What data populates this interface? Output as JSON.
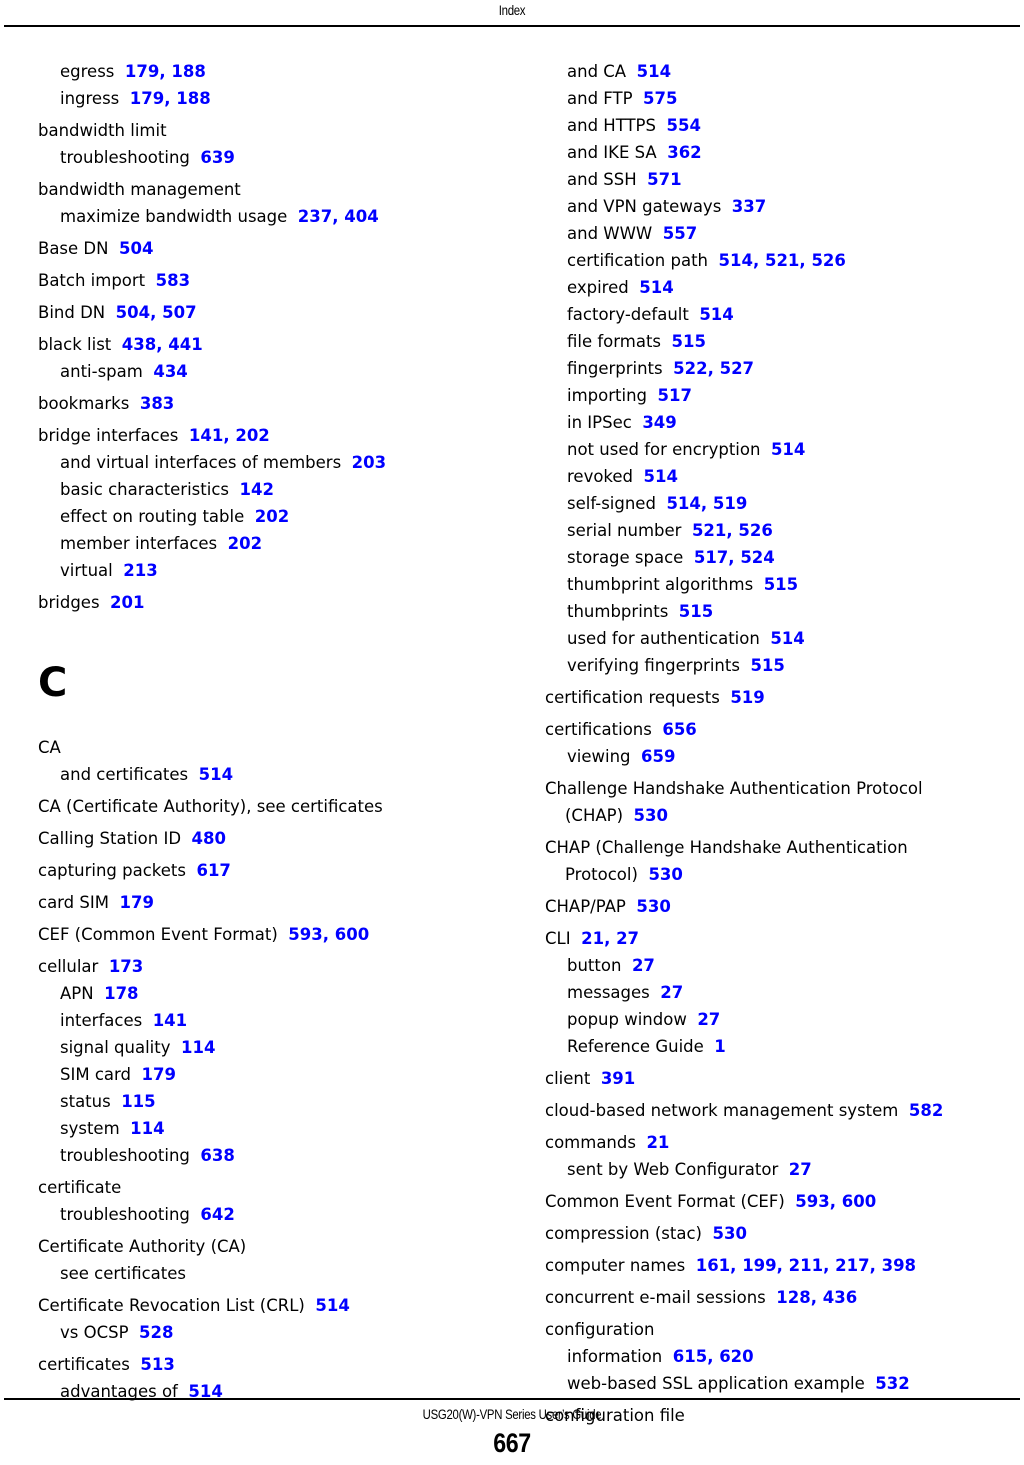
{
  "header": {
    "title": "Index"
  },
  "footer": {
    "guide_title": "USG20(W)-VPN Series User’s Guide",
    "page_number": "667"
  },
  "colors": {
    "page_link": "#0000ff",
    "text": "#000000",
    "rule": "#000000"
  },
  "columns": {
    "left": [
      {
        "type": "entry",
        "level": 1,
        "group_start": false,
        "term": "egress",
        "pages": [
          179,
          188
        ]
      },
      {
        "type": "entry",
        "level": 1,
        "group_start": false,
        "term": "ingress",
        "pages": [
          179,
          188
        ]
      },
      {
        "type": "entry",
        "level": 0,
        "group_start": true,
        "term": "bandwidth limit",
        "pages": []
      },
      {
        "type": "entry",
        "level": 1,
        "group_start": false,
        "term": "troubleshooting",
        "pages": [
          639
        ]
      },
      {
        "type": "entry",
        "level": 0,
        "group_start": true,
        "term": "bandwidth management",
        "pages": []
      },
      {
        "type": "entry",
        "level": 1,
        "group_start": false,
        "term": "maximize bandwidth usage",
        "pages": [
          237,
          404
        ]
      },
      {
        "type": "entry",
        "level": 0,
        "group_start": true,
        "term": "Base DN",
        "pages": [
          504
        ]
      },
      {
        "type": "entry",
        "level": 0,
        "group_start": true,
        "term": "Batch import",
        "pages": [
          583
        ]
      },
      {
        "type": "entry",
        "level": 0,
        "group_start": true,
        "term": "Bind DN",
        "pages": [
          504,
          507
        ]
      },
      {
        "type": "entry",
        "level": 0,
        "group_start": true,
        "term": "black list",
        "pages": [
          438,
          441
        ]
      },
      {
        "type": "entry",
        "level": 1,
        "group_start": false,
        "term": "anti-spam",
        "pages": [
          434
        ]
      },
      {
        "type": "entry",
        "level": 0,
        "group_start": true,
        "term": "bookmarks",
        "pages": [
          383
        ]
      },
      {
        "type": "entry",
        "level": 0,
        "group_start": true,
        "term": "bridge interfaces",
        "pages": [
          141,
          202
        ]
      },
      {
        "type": "entry",
        "level": 1,
        "group_start": false,
        "term": "and virtual interfaces of members",
        "pages": [
          203
        ]
      },
      {
        "type": "entry",
        "level": 1,
        "group_start": false,
        "term": "basic characteristics",
        "pages": [
          142
        ]
      },
      {
        "type": "entry",
        "level": 1,
        "group_start": false,
        "term": "effect on routing table",
        "pages": [
          202
        ]
      },
      {
        "type": "entry",
        "level": 1,
        "group_start": false,
        "term": "member interfaces",
        "pages": [
          202
        ]
      },
      {
        "type": "entry",
        "level": 1,
        "group_start": false,
        "term": "virtual",
        "pages": [
          213
        ]
      },
      {
        "type": "entry",
        "level": 0,
        "group_start": true,
        "term": "bridges",
        "pages": [
          201
        ]
      },
      {
        "type": "letter",
        "label": "C"
      },
      {
        "type": "entry",
        "level": 0,
        "group_start": false,
        "term": "CA",
        "pages": []
      },
      {
        "type": "entry",
        "level": 1,
        "group_start": false,
        "term": "and certificates",
        "pages": [
          514
        ]
      },
      {
        "type": "entry",
        "level": 0,
        "group_start": true,
        "term": "CA (Certificate Authority), see certificates",
        "pages": []
      },
      {
        "type": "entry",
        "level": 0,
        "group_start": true,
        "term": "Calling Station ID",
        "pages": [
          480
        ]
      },
      {
        "type": "entry",
        "level": 0,
        "group_start": true,
        "term": "capturing packets",
        "pages": [
          617
        ]
      },
      {
        "type": "entry",
        "level": 0,
        "group_start": true,
        "term": "card SIM",
        "pages": [
          179
        ]
      },
      {
        "type": "entry",
        "level": 0,
        "group_start": true,
        "term": "CEF (Common Event Format)",
        "pages": [
          593,
          600
        ]
      },
      {
        "type": "entry",
        "level": 0,
        "group_start": true,
        "term": "cellular",
        "pages": [
          173
        ]
      },
      {
        "type": "entry",
        "level": 1,
        "group_start": false,
        "term": "APN",
        "pages": [
          178
        ]
      },
      {
        "type": "entry",
        "level": 1,
        "group_start": false,
        "term": "interfaces",
        "pages": [
          141
        ]
      },
      {
        "type": "entry",
        "level": 1,
        "group_start": false,
        "term": "signal quality",
        "pages": [
          114
        ]
      },
      {
        "type": "entry",
        "level": 1,
        "group_start": false,
        "term": "SIM card",
        "pages": [
          179
        ]
      },
      {
        "type": "entry",
        "level": 1,
        "group_start": false,
        "term": "status",
        "pages": [
          115
        ]
      },
      {
        "type": "entry",
        "level": 1,
        "group_start": false,
        "term": "system",
        "pages": [
          114
        ]
      },
      {
        "type": "entry",
        "level": 1,
        "group_start": false,
        "term": "troubleshooting",
        "pages": [
          638
        ]
      },
      {
        "type": "entry",
        "level": 0,
        "group_start": true,
        "term": "certificate",
        "pages": []
      },
      {
        "type": "entry",
        "level": 1,
        "group_start": false,
        "term": "troubleshooting",
        "pages": [
          642
        ]
      },
      {
        "type": "entry",
        "level": 0,
        "group_start": true,
        "term": "Certificate Authority (CA)",
        "pages": []
      },
      {
        "type": "entry",
        "level": 1,
        "group_start": false,
        "term": "see certificates",
        "pages": []
      },
      {
        "type": "entry",
        "level": 0,
        "group_start": true,
        "term": "Certificate Revocation List (CRL)",
        "pages": [
          514
        ]
      },
      {
        "type": "entry",
        "level": 1,
        "group_start": false,
        "term": "vs OCSP",
        "pages": [
          528
        ]
      },
      {
        "type": "entry",
        "level": 0,
        "group_start": true,
        "term": "certificates",
        "pages": [
          513
        ]
      },
      {
        "type": "entry",
        "level": 1,
        "group_start": false,
        "term": "advantages of",
        "pages": [
          514
        ]
      }
    ],
    "right": [
      {
        "type": "entry",
        "level": 1,
        "group_start": false,
        "term": "and CA",
        "pages": [
          514
        ]
      },
      {
        "type": "entry",
        "level": 1,
        "group_start": false,
        "term": "and FTP",
        "pages": [
          575
        ]
      },
      {
        "type": "entry",
        "level": 1,
        "group_start": false,
        "term": "and HTTPS",
        "pages": [
          554
        ]
      },
      {
        "type": "entry",
        "level": 1,
        "group_start": false,
        "term": "and IKE SA",
        "pages": [
          362
        ]
      },
      {
        "type": "entry",
        "level": 1,
        "group_start": false,
        "term": "and SSH",
        "pages": [
          571
        ]
      },
      {
        "type": "entry",
        "level": 1,
        "group_start": false,
        "term": "and VPN gateways",
        "pages": [
          337
        ]
      },
      {
        "type": "entry",
        "level": 1,
        "group_start": false,
        "term": "and WWW",
        "pages": [
          557
        ]
      },
      {
        "type": "entry",
        "level": 1,
        "group_start": false,
        "term": "certification path",
        "pages": [
          514,
          521,
          526
        ]
      },
      {
        "type": "entry",
        "level": 1,
        "group_start": false,
        "term": "expired",
        "pages": [
          514
        ]
      },
      {
        "type": "entry",
        "level": 1,
        "group_start": false,
        "term": "factory-default",
        "pages": [
          514
        ]
      },
      {
        "type": "entry",
        "level": 1,
        "group_start": false,
        "term": "file formats",
        "pages": [
          515
        ]
      },
      {
        "type": "entry",
        "level": 1,
        "group_start": false,
        "term": "fingerprints",
        "pages": [
          522,
          527
        ]
      },
      {
        "type": "entry",
        "level": 1,
        "group_start": false,
        "term": "importing",
        "pages": [
          517
        ]
      },
      {
        "type": "entry",
        "level": 1,
        "group_start": false,
        "term": "in IPSec",
        "pages": [
          349
        ]
      },
      {
        "type": "entry",
        "level": 1,
        "group_start": false,
        "term": "not used for encryption",
        "pages": [
          514
        ]
      },
      {
        "type": "entry",
        "level": 1,
        "group_start": false,
        "term": "revoked",
        "pages": [
          514
        ]
      },
      {
        "type": "entry",
        "level": 1,
        "group_start": false,
        "term": "self-signed",
        "pages": [
          514,
          519
        ]
      },
      {
        "type": "entry",
        "level": 1,
        "group_start": false,
        "term": "serial number",
        "pages": [
          521,
          526
        ]
      },
      {
        "type": "entry",
        "level": 1,
        "group_start": false,
        "term": "storage space",
        "pages": [
          517,
          524
        ]
      },
      {
        "type": "entry",
        "level": 1,
        "group_start": false,
        "term": "thumbprint algorithms",
        "pages": [
          515
        ]
      },
      {
        "type": "entry",
        "level": 1,
        "group_start": false,
        "term": "thumbprints",
        "pages": [
          515
        ]
      },
      {
        "type": "entry",
        "level": 1,
        "group_start": false,
        "term": "used for authentication",
        "pages": [
          514
        ]
      },
      {
        "type": "entry",
        "level": 1,
        "group_start": false,
        "term": "verifying fingerprints",
        "pages": [
          515
        ]
      },
      {
        "type": "entry",
        "level": 0,
        "group_start": true,
        "term": "certification requests",
        "pages": [
          519
        ]
      },
      {
        "type": "entry",
        "level": 0,
        "group_start": true,
        "term": "certifications",
        "pages": [
          656
        ]
      },
      {
        "type": "entry",
        "level": 1,
        "group_start": false,
        "term": "viewing",
        "pages": [
          659
        ]
      },
      {
        "type": "entry",
        "level": 0,
        "group_start": true,
        "term": "Challenge Handshake Authentication Protocol (CHAP)",
        "pages": [
          530
        ]
      },
      {
        "type": "entry",
        "level": 0,
        "group_start": true,
        "term": "CHAP (Challenge Handshake Authentication Protocol)",
        "pages": [
          530
        ]
      },
      {
        "type": "entry",
        "level": 0,
        "group_start": true,
        "term": "CHAP/PAP",
        "pages": [
          530
        ]
      },
      {
        "type": "entry",
        "level": 0,
        "group_start": true,
        "term": "CLI",
        "pages": [
          21,
          27
        ]
      },
      {
        "type": "entry",
        "level": 1,
        "group_start": false,
        "term": "button",
        "pages": [
          27
        ]
      },
      {
        "type": "entry",
        "level": 1,
        "group_start": false,
        "term": "messages",
        "pages": [
          27
        ]
      },
      {
        "type": "entry",
        "level": 1,
        "group_start": false,
        "term": "popup window",
        "pages": [
          27
        ]
      },
      {
        "type": "entry",
        "level": 1,
        "group_start": false,
        "term": "Reference Guide",
        "pages": [
          1
        ]
      },
      {
        "type": "entry",
        "level": 0,
        "group_start": true,
        "term": "client",
        "pages": [
          391
        ]
      },
      {
        "type": "entry",
        "level": 0,
        "group_start": true,
        "term": "cloud-based network management system",
        "pages": [
          582
        ]
      },
      {
        "type": "entry",
        "level": 0,
        "group_start": true,
        "term": "commands",
        "pages": [
          21
        ]
      },
      {
        "type": "entry",
        "level": 1,
        "group_start": false,
        "term": "sent by Web Configurator",
        "pages": [
          27
        ]
      },
      {
        "type": "entry",
        "level": 0,
        "group_start": true,
        "term": "Common Event Format (CEF)",
        "pages": [
          593,
          600
        ]
      },
      {
        "type": "entry",
        "level": 0,
        "group_start": true,
        "term": "compression (stac)",
        "pages": [
          530
        ]
      },
      {
        "type": "entry",
        "level": 0,
        "group_start": true,
        "term": "computer names",
        "pages": [
          161,
          199,
          211,
          217,
          398
        ]
      },
      {
        "type": "entry",
        "level": 0,
        "group_start": true,
        "term": "concurrent e-mail sessions",
        "pages": [
          128,
          436
        ]
      },
      {
        "type": "entry",
        "level": 0,
        "group_start": true,
        "term": "configuration",
        "pages": []
      },
      {
        "type": "entry",
        "level": 1,
        "group_start": false,
        "term": "information",
        "pages": [
          615,
          620
        ]
      },
      {
        "type": "entry",
        "level": 1,
        "group_start": false,
        "term": "web-based SSL application example",
        "pages": [
          532
        ]
      },
      {
        "type": "entry",
        "level": 0,
        "group_start": true,
        "term": "configuration file",
        "pages": []
      }
    ]
  }
}
